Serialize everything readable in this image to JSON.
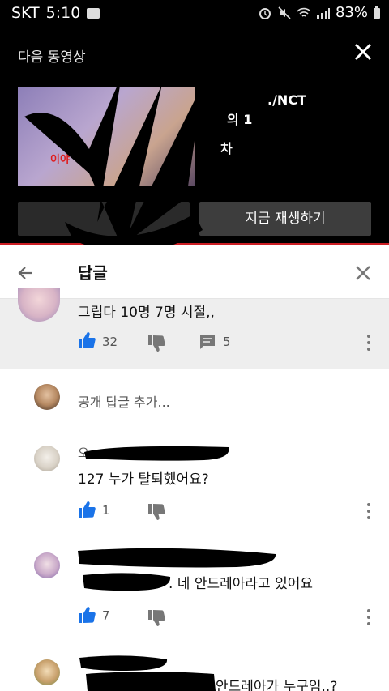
{
  "status": {
    "carrier": "SKT",
    "time": "5:10",
    "battery": "83%"
  },
  "overlay": {
    "title": "다음 동영상",
    "video_lines": [
      "./NCT",
      "의 1",
      "차"
    ],
    "thumb_text": "이야",
    "play_now": "지금 재생하기"
  },
  "header": {
    "title": "답글"
  },
  "parent": {
    "text": "그립다 10명 7명 시절,,",
    "likes": "32",
    "replies": "5"
  },
  "add_reply": {
    "placeholder": "공개 답글 추가..."
  },
  "replies": [
    {
      "author": "오",
      "text": "127 누가 탈퇴했어요?",
      "likes": "1"
    },
    {
      "author": "",
      "text": ". 네 안드레아라고 있어요",
      "likes": "7"
    },
    {
      "author": "",
      "text": "안드레아가 누구임..?",
      "likes": ""
    }
  ],
  "colors": {
    "accent_red": "#cc1e24",
    "like_blue": "#1a73e8",
    "parent_bg": "#eeeeee"
  }
}
